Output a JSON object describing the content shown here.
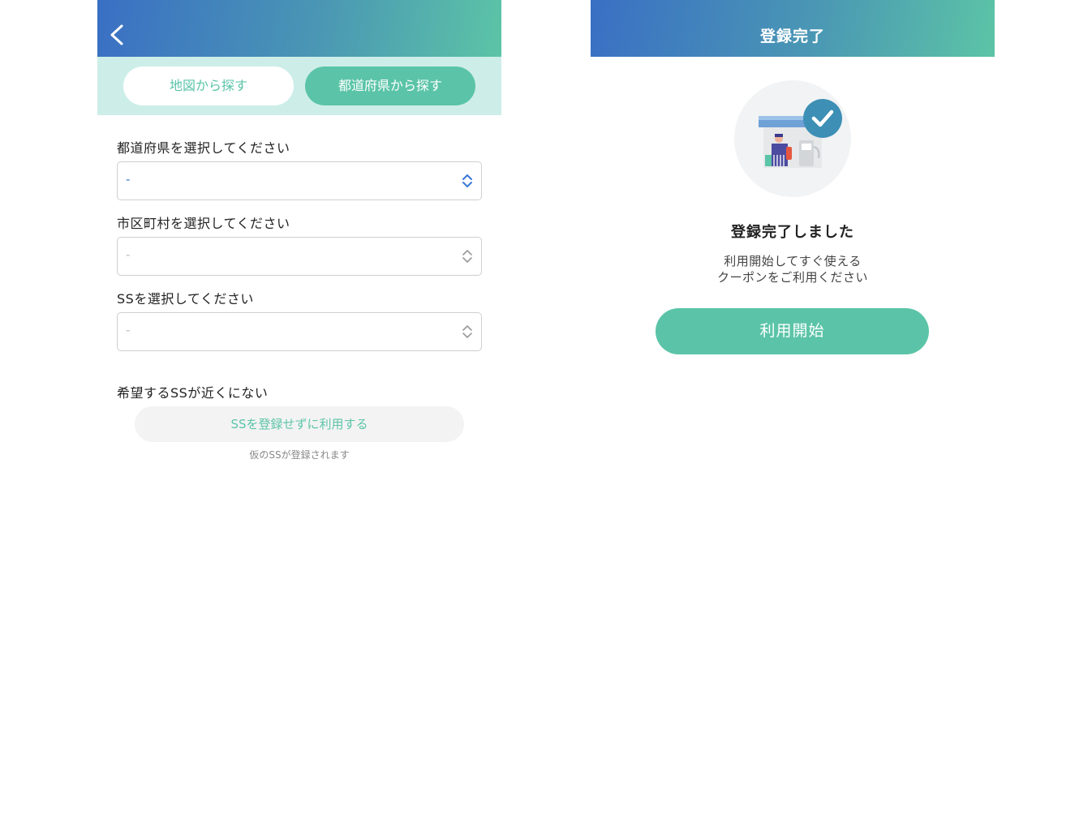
{
  "left_screen": {
    "header": {
      "back_icon": "chevron-left-icon"
    },
    "tabs": [
      {
        "label": "地図から探す",
        "selected": false
      },
      {
        "label": "都道府県から探す",
        "selected": true
      }
    ],
    "prefecture": {
      "label": "都道府県を選択してください",
      "value": "-"
    },
    "city": {
      "label": "市区町村を選択してください",
      "value": "-"
    },
    "ss": {
      "label": "SSを選択してください",
      "value": "-"
    },
    "no_nearby": {
      "subtitle": "希望するSSが近くにない",
      "button_label": "SSを登録せずに利用する",
      "note": "仮のSSが登録されます"
    }
  },
  "right_screen": {
    "header": {
      "title": "登録完了"
    },
    "illustration_icon": "gas-station-check-icon",
    "done_title": "登録完了しました",
    "message_line1": "利用開始してすぐ使える",
    "message_line2": "クーポンをご利用ください",
    "start_button_label": "利用開始"
  },
  "colors": {
    "brand_green": "#5bc4a8",
    "header_gradient_start": "#3a6fc4",
    "header_gradient_end": "#5cc4a6",
    "tab_strip_bg": "#cdeee8",
    "select_active_blue": "#3a78d6",
    "check_badge": "#3d8fb5"
  }
}
